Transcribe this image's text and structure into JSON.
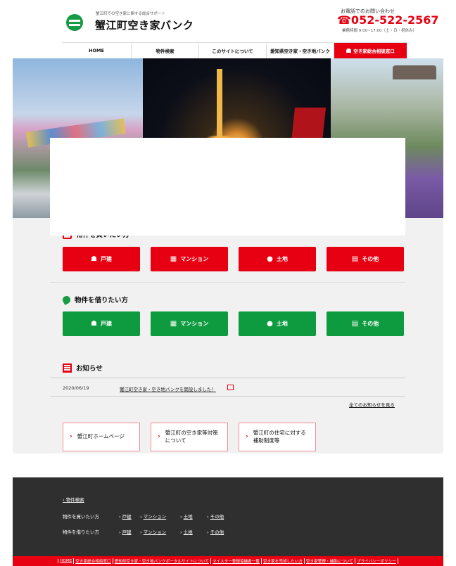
{
  "header": {
    "logo_sub": "蟹江町での空き家に関する総合サポート",
    "logo_title": "蟹江町空き家バンク",
    "contact_label": "お電話でのお問い合わせ",
    "phone": "☎052-522-2567",
    "hours": "業務時間 9:00~17:00（土・日・祝休み）"
  },
  "nav": {
    "items": [
      {
        "label": "HOME"
      },
      {
        "label": "物件検索"
      },
      {
        "label": "このサイトについて"
      },
      {
        "label": "愛知県空き家・空き地バンク"
      },
      {
        "label": "空き家総合相談窓口"
      }
    ]
  },
  "buy": {
    "title": "物件を買いたい方",
    "buttons": [
      {
        "label": "戸建",
        "icon": "house-icon"
      },
      {
        "label": "マンション",
        "icon": "building-icon"
      },
      {
        "label": "土地",
        "icon": "map-pin-icon"
      },
      {
        "label": "その他",
        "icon": "calendar-icon"
      }
    ]
  },
  "rent": {
    "title": "物件を借りたい方",
    "buttons": [
      {
        "label": "戸建",
        "icon": "house-icon"
      },
      {
        "label": "マンション",
        "icon": "building-icon"
      },
      {
        "label": "土地",
        "icon": "map-pin-icon"
      },
      {
        "label": "その他",
        "icon": "calendar-icon"
      }
    ]
  },
  "news": {
    "title": "お知らせ",
    "items": [
      {
        "date": "2020/06/19",
        "text": "蟹江町空き家・空き地バンクを開設しました！"
      }
    ],
    "all_link": "全てのお知らせを見る"
  },
  "links": [
    {
      "label": "蟹江町ホームページ"
    },
    {
      "label": "蟹江町の空き家等対策について"
    },
    {
      "label": "蟹江町の住宅に対する補助制度等"
    }
  ],
  "footer": {
    "search": "物件検索",
    "buy_label": "物件を買いたい方",
    "rent_label": "物件を借りたい方",
    "types": [
      "戸建",
      "マンション",
      "土地",
      "その他"
    ],
    "bottom_links": [
      "HOME",
      "空き家総合相談窓口",
      "愛知県空き家・空き地バンクポータルサイトについて",
      "マイスター登録協議者一覧",
      "空き家を売却したい方",
      "空き家管理・補助について",
      "プライバシーポリシー"
    ]
  },
  "colors": {
    "primary_red": "#e60012",
    "primary_green": "#0e9a3f",
    "footer_dark": "#2f2f2f"
  }
}
